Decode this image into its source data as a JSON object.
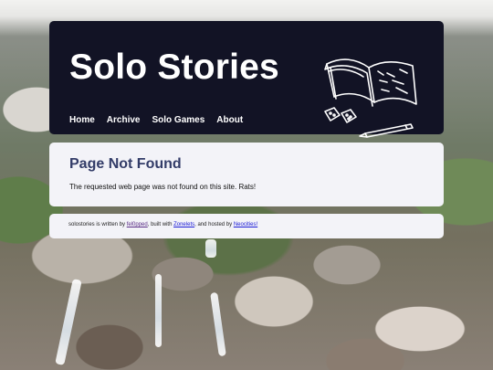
{
  "site": {
    "title": "Solo Stories",
    "nav": [
      "Home",
      "Archive",
      "Solo Games",
      "About"
    ]
  },
  "content": {
    "heading": "Page Not Found",
    "message": "The requested web page was not found on this site. Rats!"
  },
  "footer": {
    "text_1": "solostories is written by ",
    "link_author": "fel0pped",
    "text_2": ", built with ",
    "link_builder": "Zonelets",
    "text_3": ", and hosted by ",
    "link_host": "Neocities!"
  },
  "colors": {
    "header_bg": "#121325",
    "card_bg": "#f3f3f8",
    "heading": "#333c68"
  }
}
